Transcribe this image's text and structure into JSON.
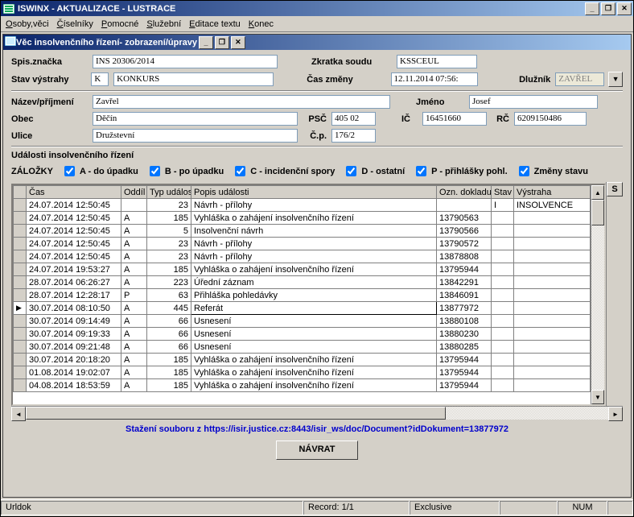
{
  "window": {
    "title": "ISWINX - AKTUALIZACE - LUSTRACE"
  },
  "menu": {
    "osoby": "Osoby,věci",
    "ciselniky": "Číselníky",
    "pomocne": "Pomocné",
    "sluzebni": "Služební",
    "editace": "Editace textu",
    "konec": "Konec"
  },
  "inner": {
    "title": "Věc insolvenčního řízení- zobrazení/úpravy"
  },
  "labels": {
    "spis": "Spis.značka",
    "zkratka": "Zkratka soudu",
    "stav": "Stav výstrahy",
    "cas": "Čas změny",
    "dluznik": "Dlužník",
    "nazev": "Název/příjmení",
    "jmeno": "Jméno",
    "obec": "Obec",
    "psc": "PSČ",
    "ic": "IČ",
    "rc": "RČ",
    "ulice": "Ulice",
    "cp": "Č.p.",
    "udalosti": "Události  insolvenčního řízení",
    "zalozky": "ZÁLOŽKY"
  },
  "fields": {
    "spis": "INS 20306/2014",
    "zkratka": "KSSCEUL",
    "stavK": "K",
    "stavText": "KONKURS",
    "cas": "12.11.2014 07:56:",
    "dluznik": "ZAVŘEL",
    "nazev": "Zavřel",
    "jmeno": "Josef",
    "obec": "Děčín",
    "psc": "405 02",
    "ic": "16451660",
    "rc": "6209150486",
    "ulice": "Družstevní",
    "cp": "176/2"
  },
  "checks": {
    "a": "A - do úpadku",
    "b": "B - po úpadku",
    "c": "C - incidenční spory",
    "d": "D - ostatní",
    "p": "P - přihlášky pohl.",
    "z": "Změny stavu"
  },
  "columns": {
    "cas": "Čas",
    "oddil": "Oddíl",
    "typ": "Typ událos",
    "popis": "Popis události",
    "ozn": "Ozn. dokladu",
    "stav": "Stav",
    "vystraha": "Výstraha",
    "s": "S"
  },
  "rows": [
    {
      "cas": "24.07.2014 12:50:45",
      "oddil": "",
      "typ": "23",
      "popis": "Návrh - přílohy",
      "ozn": "",
      "stav": "I",
      "vyst": "INSOLVENCE"
    },
    {
      "cas": "24.07.2014 12:50:45",
      "oddil": "A",
      "typ": "185",
      "popis": "Vyhláška o zahájení insolvenčního řízení",
      "ozn": "13790563",
      "stav": "",
      "vyst": ""
    },
    {
      "cas": "24.07.2014 12:50:45",
      "oddil": "A",
      "typ": "5",
      "popis": "Insolvenční návrh",
      "ozn": "13790566",
      "stav": "",
      "vyst": ""
    },
    {
      "cas": "24.07.2014 12:50:45",
      "oddil": "A",
      "typ": "23",
      "popis": "Návrh - přílohy",
      "ozn": "13790572",
      "stav": "",
      "vyst": ""
    },
    {
      "cas": "24.07.2014 12:50:45",
      "oddil": "A",
      "typ": "23",
      "popis": "Návrh - přílohy",
      "ozn": "13878808",
      "stav": "",
      "vyst": ""
    },
    {
      "cas": "24.07.2014 19:53:27",
      "oddil": "A",
      "typ": "185",
      "popis": "Vyhláška o zahájení insolvenčního řízení",
      "ozn": "13795944",
      "stav": "",
      "vyst": ""
    },
    {
      "cas": "28.07.2014 06:26:27",
      "oddil": "A",
      "typ": "223",
      "popis": "Úřední záznam",
      "ozn": "13842291",
      "stav": "",
      "vyst": ""
    },
    {
      "cas": "28.07.2014 12:28:17",
      "oddil": "P",
      "typ": "63",
      "popis": "Přihláška pohledávky",
      "ozn": "13846091",
      "stav": "",
      "vyst": ""
    },
    {
      "cas": "30.07.2014 08:10:50",
      "oddil": "A",
      "typ": "445",
      "popis": "Referát",
      "ozn": "13877972",
      "stav": "",
      "vyst": "",
      "sel": true
    },
    {
      "cas": "30.07.2014 09:14:49",
      "oddil": "A",
      "typ": "66",
      "popis": "Usnesení",
      "ozn": "13880108",
      "stav": "",
      "vyst": ""
    },
    {
      "cas": "30.07.2014 09:19:33",
      "oddil": "A",
      "typ": "66",
      "popis": "Usnesení",
      "ozn": "13880230",
      "stav": "",
      "vyst": ""
    },
    {
      "cas": "30.07.2014 09:21:48",
      "oddil": "A",
      "typ": "66",
      "popis": "Usnesení",
      "ozn": "13880285",
      "stav": "",
      "vyst": ""
    },
    {
      "cas": "30.07.2014 20:18:20",
      "oddil": "A",
      "typ": "185",
      "popis": "Vyhláška o zahájení insolvenčního řízení",
      "ozn": "13795944",
      "stav": "",
      "vyst": ""
    },
    {
      "cas": "01.08.2014 19:02:07",
      "oddil": "A",
      "typ": "185",
      "popis": "Vyhláška o zahájení insolvenčního řízení",
      "ozn": "13795944",
      "stav": "",
      "vyst": ""
    },
    {
      "cas": "04.08.2014 18:53:59",
      "oddil": "A",
      "typ": "185",
      "popis": "Vyhláška o zahájení insolvenčního řízení",
      "ozn": "13795944",
      "stav": "",
      "vyst": ""
    }
  ],
  "link": "Stažení souboru z https://isir.justice.cz:8443/isir_ws/doc/Document?idDokument=13877972",
  "buttons": {
    "navrat": "NÁVRAT"
  },
  "status": {
    "urldok": "Urldok",
    "record": "Record: 1/1",
    "excl": "Exclusive",
    "num": "NUM"
  }
}
